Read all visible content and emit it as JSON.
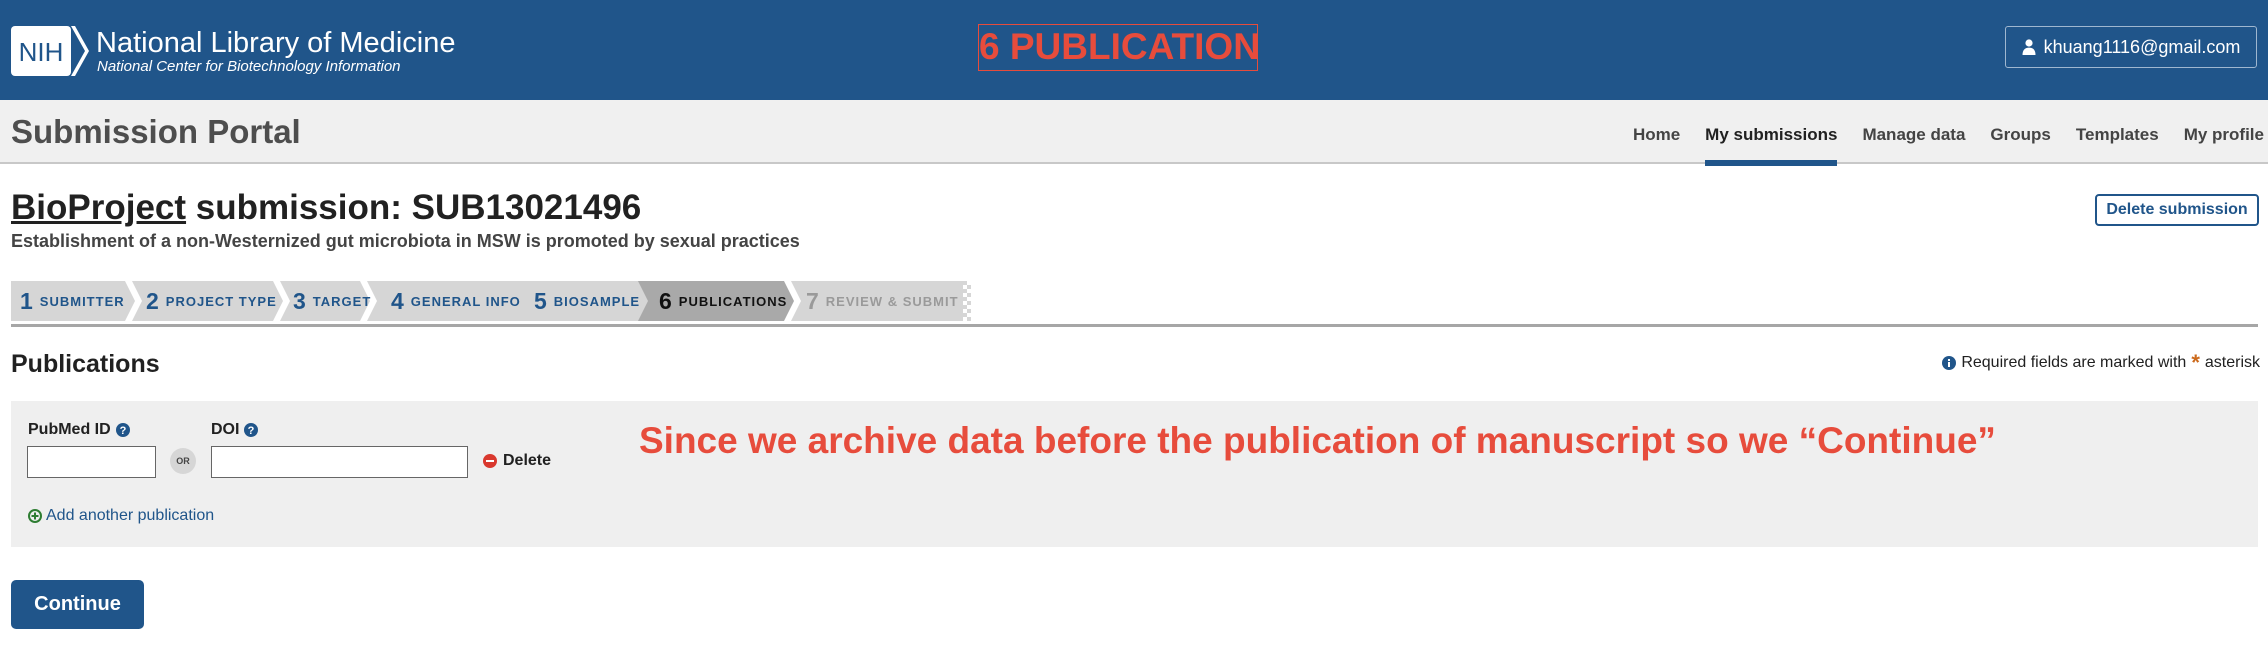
{
  "header": {
    "nih_logo_text": "NIH",
    "org_name": "National Library of Medicine",
    "org_subtitle": "National Center for Biotechnology Information",
    "step_banner": "6 PUBLICATION",
    "user_email": "khuang1116@gmail.com",
    "brand_color": "#20558a",
    "annotation_color": "#e74c3c"
  },
  "portal": {
    "title": "Submission Portal",
    "nav": [
      {
        "label": "Home",
        "active": false
      },
      {
        "label": "My submissions",
        "active": true
      },
      {
        "label": "Manage data",
        "active": false
      },
      {
        "label": "Groups",
        "active": false
      },
      {
        "label": "Templates",
        "active": false
      },
      {
        "label": "My profile",
        "active": false
      }
    ]
  },
  "submission": {
    "type_link": "BioProject",
    "title_rest": " submission: SUB13021496",
    "description": "Establishment of a non-Westernized gut microbiota in MSW is promoted by sexual practices",
    "delete_label": "Delete submission"
  },
  "wizard": {
    "steps": [
      {
        "num": "1",
        "label": "SUBMITTER",
        "state": "done"
      },
      {
        "num": "2",
        "label": "PROJECT TYPE",
        "state": "done"
      },
      {
        "num": "3",
        "label": "TARGET",
        "state": "done"
      },
      {
        "num": "4",
        "label": "GENERAL INFO",
        "state": "done"
      },
      {
        "num": "5",
        "label": "BIOSAMPLE",
        "state": "done"
      },
      {
        "num": "6",
        "label": "PUBLICATIONS",
        "state": "current"
      },
      {
        "num": "7",
        "label": "REVIEW & SUBMIT",
        "state": "future"
      }
    ]
  },
  "publications": {
    "heading": "Publications",
    "required_note": "Required fields are marked with",
    "required_word": "asterisk",
    "pubmed_label": "PubMed ID",
    "pubmed_value": "",
    "or_label": "OR",
    "doi_label": "DOI",
    "doi_value": "",
    "delete_label": "Delete",
    "add_label": "Add another publication",
    "annotation": "Since we archive data before the publication of manuscript so we “Continue”"
  },
  "actions": {
    "continue_label": "Continue"
  }
}
